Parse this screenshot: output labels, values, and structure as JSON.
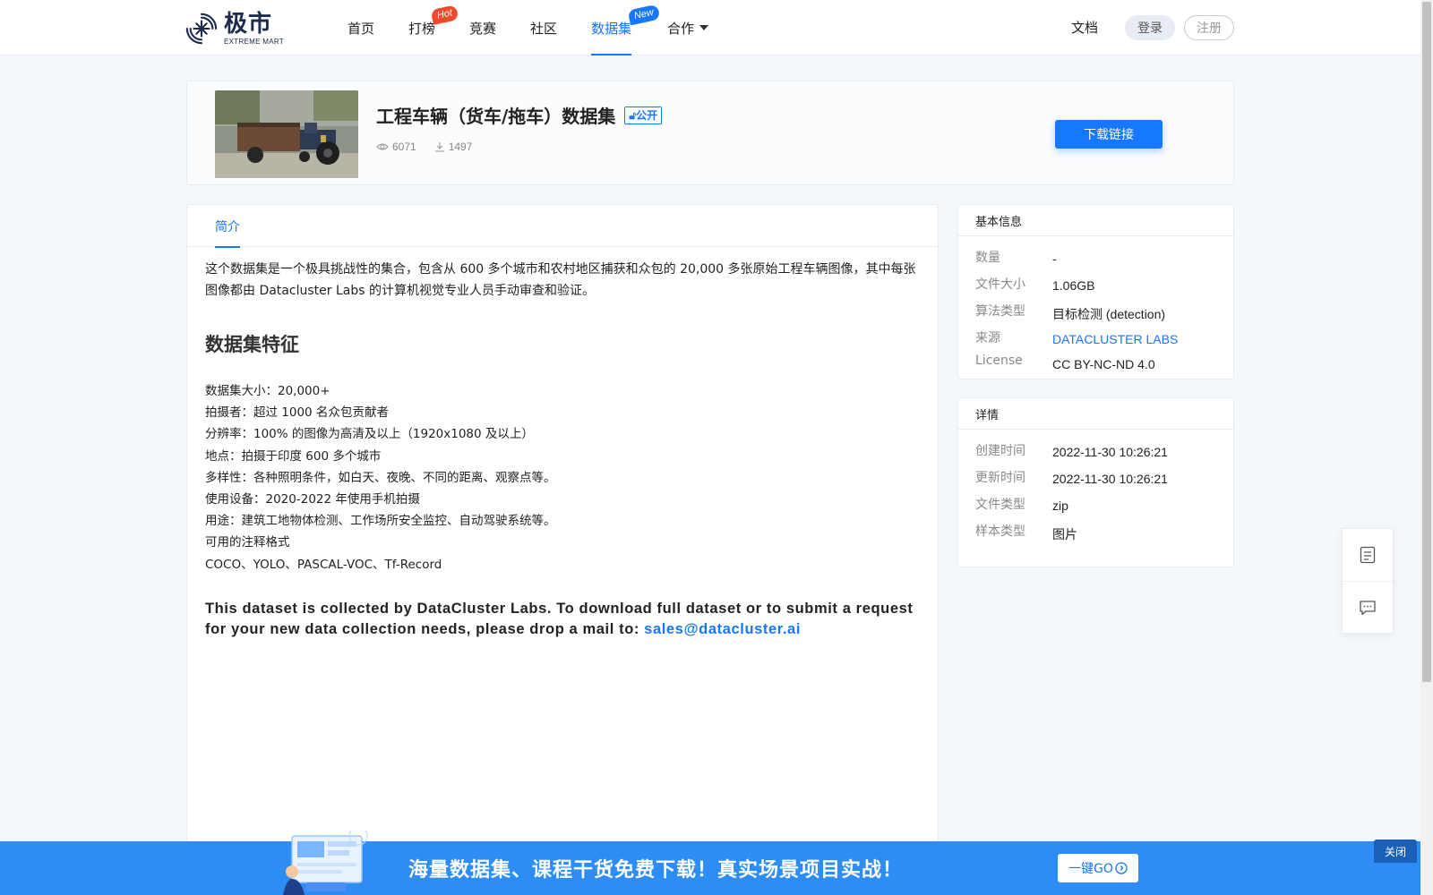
{
  "nav": {
    "logo_cn": "极市",
    "logo_en": "EXTREME MART",
    "items": [
      {
        "label": "首页"
      },
      {
        "label": "打榜",
        "badge": "Hot"
      },
      {
        "label": "竞赛"
      },
      {
        "label": "社区"
      },
      {
        "label": "数据集",
        "badge": "New",
        "active": true
      },
      {
        "label": "合作"
      }
    ],
    "docs": "文档",
    "login": "登录",
    "register": "注册"
  },
  "dataset": {
    "title": "工程车辆（货车/拖车）数据集",
    "visibility": "公开",
    "views": "6071",
    "downloads": "1497",
    "download_button": "下载链接"
  },
  "tabs": [
    "简介"
  ],
  "intro": "这个数据集是一个极具挑战性的集合，包含从 600 多个城市和农村地区捕获和众包的 20,000 多张原始工程车辆图像，其中每张图像都由 Datacluster Labs 的计算机视觉专业人员手动审查和验证。",
  "features": {
    "title": "数据集特征",
    "items": [
      "数据集大小：20,000+",
      "拍摄者：超过 1000 名众包贡献者",
      "分辨率：100% 的图像为高清及以上（1920x1080 及以上）",
      "地点：拍摄于印度 600 多个城市",
      "多样性：各种照明条件，如白天、夜晚、不同的距离、观察点等。",
      "使用设备：2020-2022 年使用手机拍摄",
      "用途：建筑工地物体检测、工作场所安全监控、自动驾驶系统等。",
      "可用的注释格式",
      "COCO、YOLO、PASCAL-VOC、Tf-Record"
    ]
  },
  "english_note": {
    "text": "This dataset is collected by DataCluster Labs. To download full dataset or to submit a request for your new data collection needs, please drop a mail to: ",
    "email": "sales@datacluster.ai"
  },
  "basic_info": {
    "title": "基本信息",
    "rows": [
      {
        "key": "数量",
        "value": "-"
      },
      {
        "key": "文件大小",
        "value": "1.06GB"
      },
      {
        "key": "算法类型",
        "value": "目标检测 (detection)"
      },
      {
        "key": "来源",
        "value": "DATACLUSTER LABS"
      },
      {
        "key": "License",
        "value": "CC BY-NC-ND 4.0"
      }
    ]
  },
  "details": {
    "title": "详情",
    "rows": [
      {
        "key": "创建时间",
        "value": "2022-11-30 10:26:21"
      },
      {
        "key": "更新时间",
        "value": "2022-11-30 10:26:21"
      },
      {
        "key": "文件类型",
        "value": "zip"
      },
      {
        "key": "样本类型",
        "value": "图片"
      }
    ]
  },
  "promo": {
    "text": "海量数据集、课程干货免费下载！真实场景项目实战！",
    "go": "一键GO",
    "close": "关闭"
  },
  "colors": {
    "accent": "#1677ff",
    "hot_badge": "#f04a2c",
    "promo_bg": "#2e8df5"
  }
}
